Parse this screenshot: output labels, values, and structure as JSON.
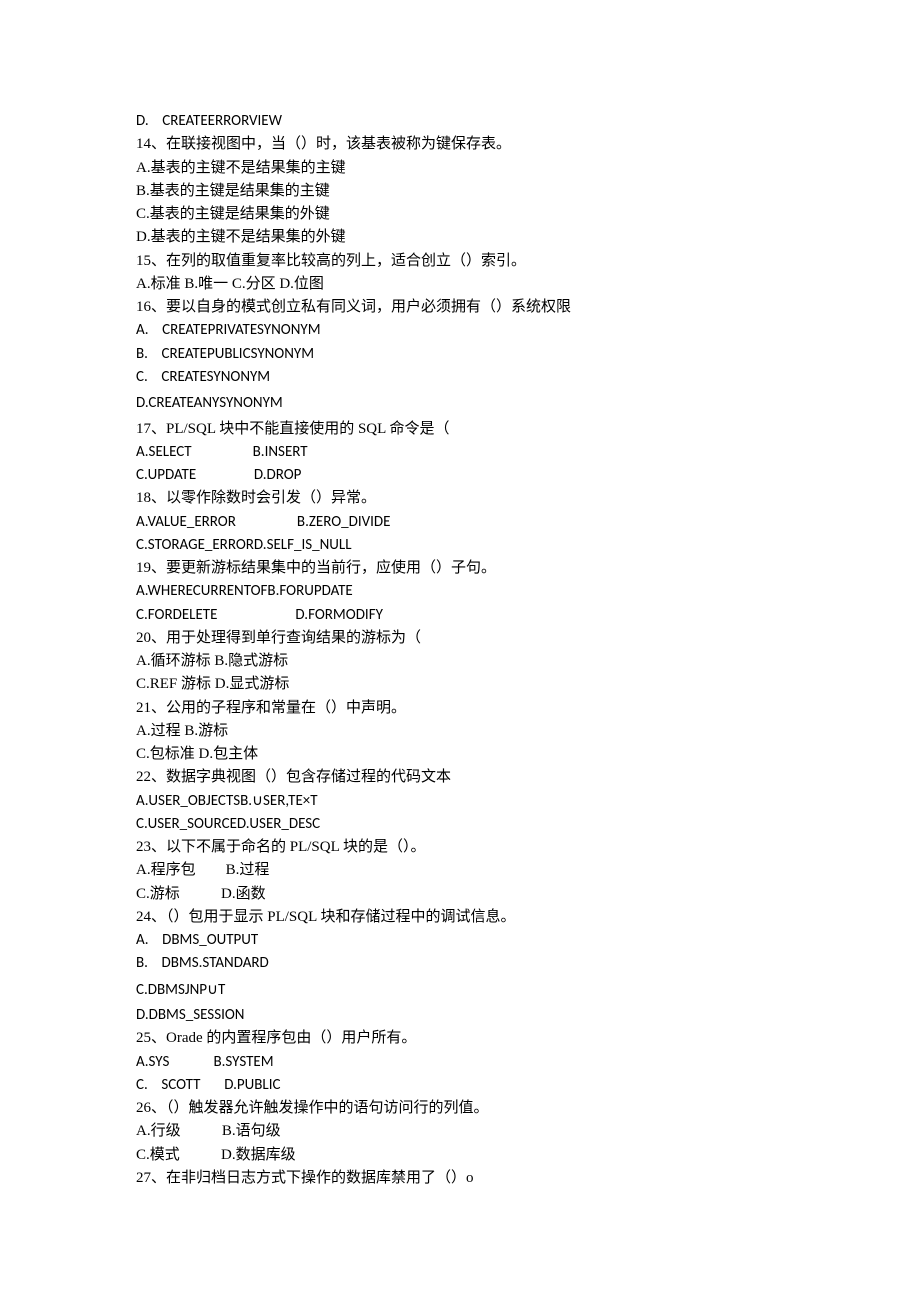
{
  "lines": [
    {
      "key": "l00",
      "text": "D.    CREATEERRORVIEW",
      "latinAll": true
    },
    {
      "key": "l01a",
      "text": "14、在联接视图中，当（）时，该基表被称为键保存表。"
    },
    {
      "key": "l01b",
      "text": "A.基表的主键不是结果集的主键"
    },
    {
      "key": "l01c",
      "text": "B.基表的主键是结果集的主键"
    },
    {
      "key": "l01d",
      "text": "C.基表的主键是结果集的外键"
    },
    {
      "key": "l01e",
      "text": "D.基表的主键不是结果集的外键"
    },
    {
      "key": "l02",
      "text": "15、在列的取值重复率比较高的列上，适合创立（）索引。"
    },
    {
      "key": "l03",
      "text": "A.标准 B.唯一 C.分区 D.位图"
    },
    {
      "key": "l04",
      "text": "16、要以自身的模式创立私有同义词，用户必须拥有（）系统权限"
    },
    {
      "key": "l05",
      "text": "A.    CREATEPRIVATESYNONYM",
      "latinAll": true
    },
    {
      "key": "l06",
      "text": "B.    CREATEPUBLICSYNONYM",
      "latinAll": true
    },
    {
      "key": "l07",
      "text": "C.    CREATESYNONYM",
      "latinAll": true
    },
    {
      "key": "l08",
      "text": "D.CREATEANYSYNONYM",
      "latinAll": true,
      "big": true
    },
    {
      "key": "l09a",
      "text": "17、PL/SQL 块中不能直接使用的 SQL 命令是（"
    },
    {
      "key": "l09b",
      "text": "A.SELECT                  B.INSERT",
      "latinAll": true
    },
    {
      "key": "l09c",
      "text": "C.UPDATE                 D.DROP",
      "latinAll": true
    },
    {
      "key": "l10",
      "text": "18、以零作除数时会引发（）异常。"
    },
    {
      "key": "l11",
      "text": "A.VALUE_ERROR                  B.ZERO_DIVIDE",
      "latinAll": true
    },
    {
      "key": "l12",
      "text": "C.STORAGE_ERRORD.SELF_IS_NULL",
      "latinAll": true
    },
    {
      "key": "l13",
      "text": "19、要更新游标结果集中的当前行，应使用（）子句。"
    },
    {
      "key": "l14",
      "text": "A.WHERECURRENTOFB.FORUPDATE",
      "latinAll": true
    },
    {
      "key": "l15",
      "text": "C.FORDELETE                       D.FORMODIFY",
      "latinAll": true
    },
    {
      "key": "l16a",
      "text": "20、用于处理得到单行查询结果的游标为（"
    },
    {
      "key": "l16b",
      "text": "A.循环游标 B.隐式游标"
    },
    {
      "key": "l16c",
      "text": "C.REF 游标 D.显式游标"
    },
    {
      "key": "l17",
      "text": "21、公用的子程序和常量在（）中声明。"
    },
    {
      "key": "l18",
      "text": "A.过程 B.游标"
    },
    {
      "key": "l19",
      "text": "C.包标准 D.包主体"
    },
    {
      "key": "l20",
      "text": "22、数据字典视图（）包含存储过程的代码文本"
    },
    {
      "key": "l21",
      "text": "A.USER_OBJECTSB.∪SER,TE×T",
      "latinAll": true
    },
    {
      "key": "l22",
      "text": "C.USER_SOURCED.USER_DESC",
      "latinAll": true
    },
    {
      "key": "l23",
      "text": "23、以下不属于命名的 PL/SQL 块的是（）。"
    },
    {
      "key": "l24",
      "text": "A.程序包        B.过程"
    },
    {
      "key": "l25",
      "text": "C.游标           D.函数"
    },
    {
      "key": "l26",
      "text": "24、（）包用于显示 PL/SQL 块和存储过程中的调试信息。"
    },
    {
      "key": "l27",
      "text": "A.    DBMS_OUTPUT",
      "latinAll": true
    },
    {
      "key": "l28",
      "text": "B.    DBMS.STANDARD",
      "latinAll": true
    },
    {
      "key": "l29",
      "text": "C.DBMSJNP∪T",
      "latinAll": true,
      "big": true
    },
    {
      "key": "l30",
      "text": "D.DBMS_SESSION",
      "latinAll": true
    },
    {
      "key": "l31",
      "text": "25、Orade 的内置程序包由（）用户所有。"
    },
    {
      "key": "l32",
      "text": "A.SYS             B.SYSTEM",
      "latinAll": true
    },
    {
      "key": "l33",
      "text": "C.    SCOTT       D.PUBLIC",
      "latinAll": true
    },
    {
      "key": "l34",
      "text": "26、（）触发器允许触发操作中的语句访问行的列值。"
    },
    {
      "key": "l35",
      "text": "A.行级           B.语句级"
    },
    {
      "key": "l36",
      "text": "C.模式           D.数据库级"
    },
    {
      "key": "l37",
      "text": "27、在非归档日志方式下操作的数据库禁用了（）o"
    }
  ]
}
